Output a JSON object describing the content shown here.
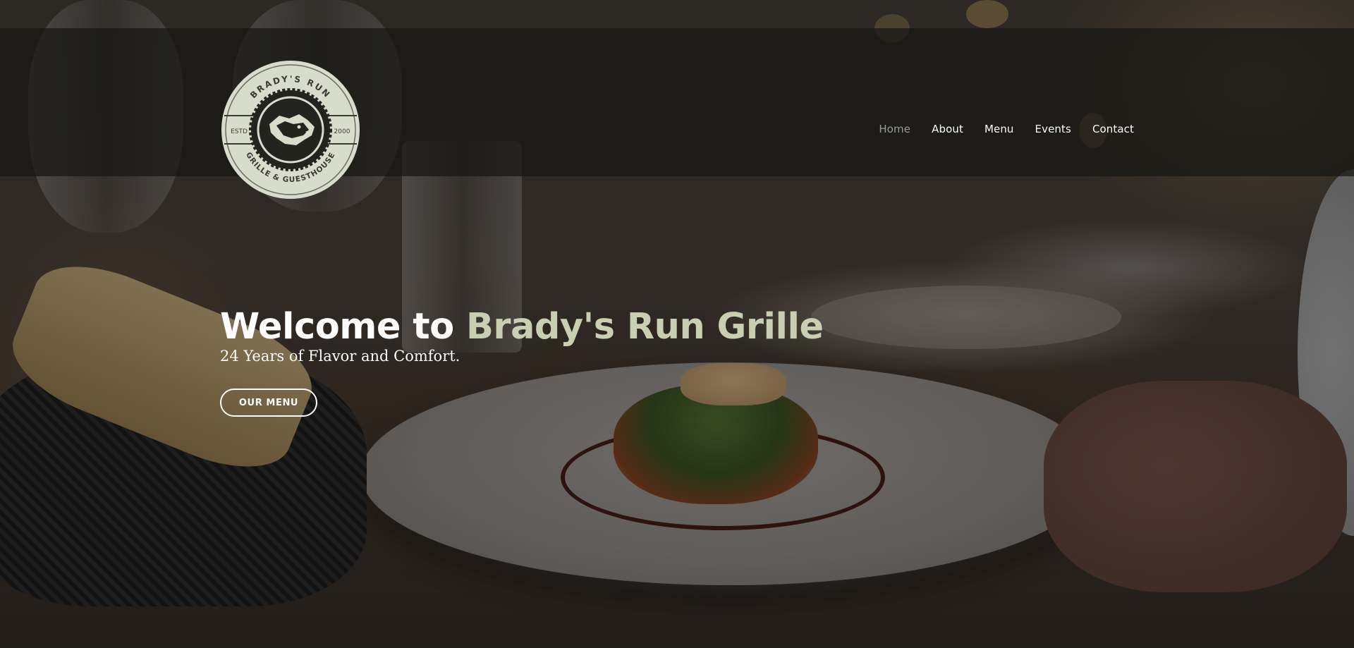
{
  "logo": {
    "top_text": "BRADY'S RUN",
    "left_text": "ESTD",
    "right_text": "2000",
    "bottom_text": "GRILLE & GUESTHOUSE",
    "emblem_icon": "boar-head-icon",
    "ring_color": "#d8dccb",
    "emblem_color": "#24241f"
  },
  "nav": {
    "items": [
      {
        "label": "Home",
        "active": true
      },
      {
        "label": "About",
        "active": false
      },
      {
        "label": "Menu",
        "active": false
      },
      {
        "label": "Events",
        "active": false
      },
      {
        "label": "Contact",
        "active": false
      }
    ]
  },
  "hero": {
    "title_prefix": "Welcome to",
    "title_accent": "Brady's Run Grille",
    "subtitle": "24 Years of Flavor and Comfort.",
    "button_label": "OUR MENU",
    "accent_color": "#c8cfb2"
  }
}
